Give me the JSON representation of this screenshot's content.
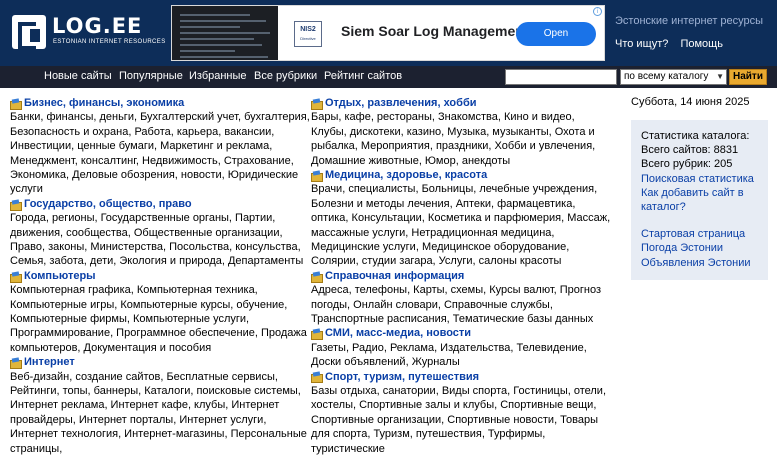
{
  "header": {
    "logo_text": "LOG.EE",
    "logo_subtitle": "ESTONIAN INTERNET RESOURCES",
    "tagline": "Эстонские интернет ресурсы",
    "links": [
      "Что ищут?",
      "Помощь"
    ]
  },
  "ad": {
    "badge": "NIS2",
    "badge_sub": "Directive",
    "title": "Siem Soar Log Management",
    "button": "Open",
    "info_icon": "i"
  },
  "nav": {
    "items": [
      "Новые сайты",
      "Популярные",
      "Избранные",
      "Все рубрики",
      "Рейтинг сайтов"
    ],
    "search_value": "",
    "scope_selected": "по всему каталогу",
    "find_button": "Найти"
  },
  "categories_left": [
    {
      "title": "Бизнес, финансы, экономика",
      "subs": "Банки, финансы, деньги, Бухгалтерский учет, бухгалтерия, Безопасность и охрана, Работа, карьера, вакансии, Инвестиции, ценные бумаги, Маркетинг и реклама, Менеджмент, консалтинг, Недвижимость, Страхование, Экономика, Деловые обозрения, новости, Юридические услуги"
    },
    {
      "title": "Государство, общество, право",
      "subs": "Города, регионы, Государственные органы, Партии, движения, сообщества, Общественные организации, Право, законы, Министерства, Посольства, консульства, Семья, забота, дети, Экология и природа, Департаменты"
    },
    {
      "title": "Компьютеры",
      "subs": "Компьютерная графика, Компьютерная техника, Компьютерные игры, Компьютерные курсы, обучение, Компьютерные фирмы, Компьютерные услуги, Программирование, Программное обеспечение, Продажа компьютеров, Документация и пособия"
    },
    {
      "title": "Интернет",
      "subs": "Веб-дизайн, создание сайтов, Бесплатные сервисы, Рейтинги, топы, баннеры, Каталоги, поисковые системы, Интернет реклама, Интернет кафе, клубы, Интернет провайдеры, Интернет порталы, Интернет услуги, Интернет технология, Интернет-магазины, Персональные страницы,"
    }
  ],
  "categories_right": [
    {
      "title": "Отдых, развлечения, хобби",
      "subs": "Бары, кафе, рестораны, Знакомства, Кино и видео, Клубы, дискотеки, казино, Музыка, музыканты, Охота и рыбалка, Мероприятия, праздники, Хобби и увлечения, Домашние животные, Юмор, анекдоты"
    },
    {
      "title": "Медицина, здоровье, красота",
      "subs": "Врачи, специалисты, Больницы, лечебные учреждения, Болезни и методы лечения, Аптеки, фармацевтика, оптика, Консультации, Косметика и парфюмерия, Массаж, массажные услуги, Нетрадиционная медицина, Медицинские услуги, Медицинское оборудование, Солярии, студии загара, Услуги, салоны красоты"
    },
    {
      "title": "Справочная информация",
      "subs": "Адреса, телефоны, Карты, схемы, Курсы валют, Прогноз погоды, Онлайн словари, Справочные службы, Транспортные расписания, Тематические базы данных"
    },
    {
      "title": "СМИ, масс-медиа, новости",
      "subs": "Газеты, Радио, Реклама, Издательства, Телевидение, Доски объявлений, Журналы"
    },
    {
      "title": "Спорт, туризм, путешествия",
      "subs": "Базы отдыха, санатории, Виды спорта, Гостиницы, отели, хостелы, Спортивные залы и клубы, Спортивные вещи, Спортивные организации, Спортивные новости, Товары для спорта, Туризм, путешествия, Турфирмы, туристические"
    }
  ],
  "sidebar": {
    "date": "Суббота, 14 июня 2025",
    "stats_title": "Статистика каталога:",
    "sites_count": "Всего сайтов: 8831",
    "rubrics_count": "Всего рубрик: 205",
    "search_stats_link": "Поисковая статистика",
    "add_site_link": "Как добавить сайт в каталог?",
    "extra_links": [
      "Стартовая страница",
      "Погода Эстонии",
      "Объявления Эстонии"
    ]
  }
}
